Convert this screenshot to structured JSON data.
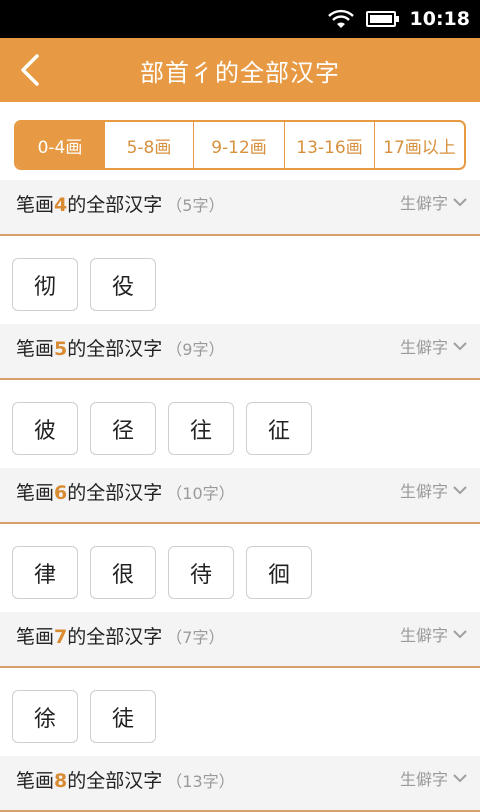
{
  "status": {
    "time": "10:18"
  },
  "header": {
    "title": "部首彳的全部汉字"
  },
  "tabs": [
    "0-4画",
    "5-8画",
    "9-12画",
    "13-16画",
    "17画以上"
  ],
  "active_tab": 0,
  "rare_label": "生僻字",
  "sections": [
    {
      "prefix": "笔画",
      "num": "4",
      "suffix": "的全部汉字",
      "count": "（5字）",
      "chars": [
        "彻",
        "役"
      ]
    },
    {
      "prefix": "笔画",
      "num": "5",
      "suffix": "的全部汉字",
      "count": "（9字）",
      "chars": [
        "彼",
        "径",
        "往",
        "征"
      ]
    },
    {
      "prefix": "笔画",
      "num": "6",
      "suffix": "的全部汉字",
      "count": "（10字）",
      "chars": [
        "律",
        "很",
        "待",
        "徊"
      ]
    },
    {
      "prefix": "笔画",
      "num": "7",
      "suffix": "的全部汉字",
      "count": "（7字）",
      "chars": [
        "徐",
        "徒"
      ]
    },
    {
      "prefix": "笔画",
      "num": "8",
      "suffix": "的全部汉字",
      "count": "（13字）",
      "chars": []
    }
  ],
  "colors": {
    "accent": "#e79a43",
    "number": "#d98b34"
  }
}
